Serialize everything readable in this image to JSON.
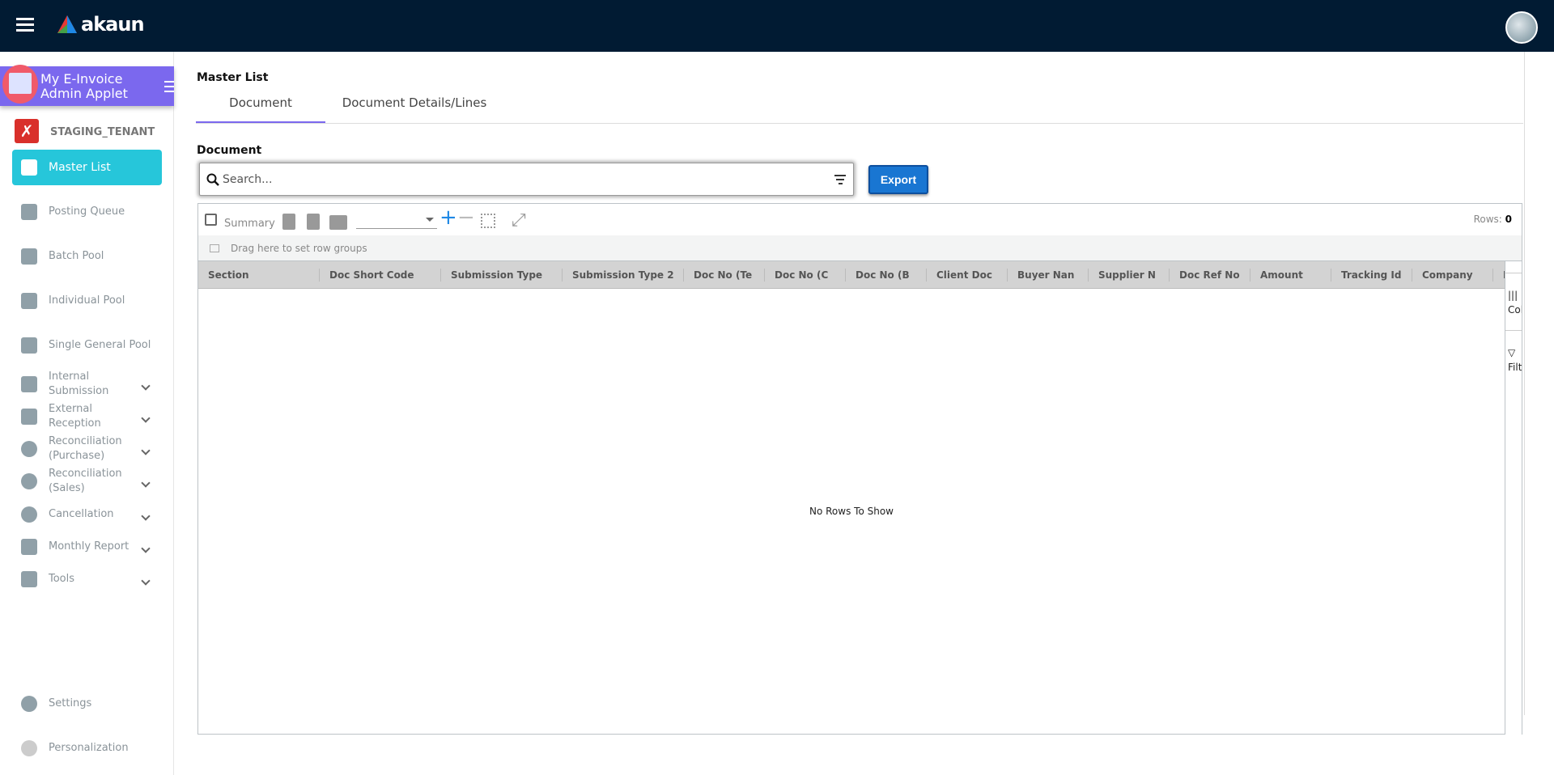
{
  "topbar": {
    "brand": "akaun"
  },
  "sidebar": {
    "applet_title": "My E-Invoice Admin Applet",
    "tenant": "STAGING_TENANT",
    "items": [
      {
        "label": "Master List",
        "icon": "table-icon",
        "active": true
      },
      {
        "label": "Posting Queue",
        "icon": "list-icon"
      },
      {
        "label": "Batch Pool",
        "icon": "waves-icon"
      },
      {
        "label": "Individual Pool",
        "icon": "inbox-icon"
      },
      {
        "label": "Single General Pool",
        "icon": "inbox-icon"
      },
      {
        "label": "Internal Submission",
        "icon": "calendar-refresh-icon",
        "expandable": true
      },
      {
        "label": "External Reception",
        "icon": "external-link-icon",
        "expandable": true
      },
      {
        "label": "Reconciliation (Purchase)",
        "icon": "overlap-circles-icon",
        "expandable": true
      },
      {
        "label": "Reconciliation (Sales)",
        "icon": "overlap-circles-icon",
        "expandable": true
      },
      {
        "label": "Cancellation",
        "icon": "cancel-circle-icon",
        "expandable": true
      },
      {
        "label": "Monthly Report",
        "icon": "calendar-icon",
        "expandable": true
      },
      {
        "label": "Tools",
        "icon": "wrench-icon",
        "expandable": true
      }
    ],
    "settings": "Settings",
    "personalization": "Personalization"
  },
  "main": {
    "section_title": "Master List",
    "tabs": [
      {
        "label": "Document",
        "active": true
      },
      {
        "label": "Document Details/Lines"
      }
    ],
    "doc_label": "Document",
    "search_placeholder": "Search...",
    "export_label": "Export",
    "grid": {
      "summary_label": "Summary",
      "rows_label": "Rows:",
      "rows_count": "0",
      "group_hint": "Drag here to set row groups",
      "columns": [
        "Section",
        "Doc Short Code",
        "Submission Type",
        "Submission Type 2",
        "Doc No (Te",
        "Doc No (C",
        "Doc No (B",
        "Client Doc",
        "Buyer Nan",
        "Supplier N",
        "Doc Ref No",
        "Amount",
        "Tracking Id",
        "Company",
        "E"
      ],
      "side_columns": "Columns",
      "side_filters": "Filters",
      "empty": "No Rows To Show"
    }
  },
  "colors": {
    "topbar": "#011b33",
    "applet": "#7b68ee",
    "active_nav": "#26c6da",
    "export": "#1976d2"
  }
}
